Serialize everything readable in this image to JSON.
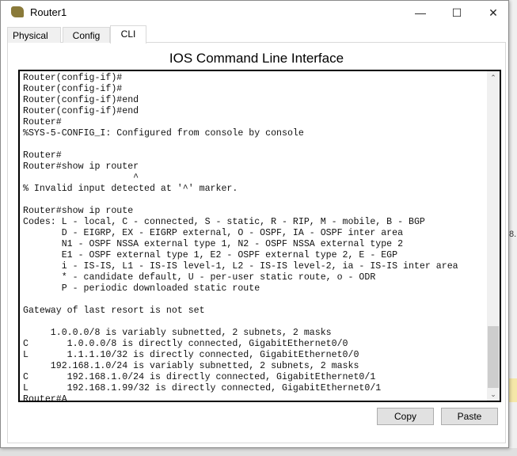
{
  "window": {
    "title": "Router1"
  },
  "tabs": [
    {
      "label": "Physical"
    },
    {
      "label": "Config"
    },
    {
      "label": "CLI",
      "active": true
    }
  ],
  "heading": "IOS Command Line Interface",
  "terminal": {
    "lines": [
      "Router(config-if)#",
      "Router(config-if)#",
      "Router(config-if)#",
      "Router(config-if)#end",
      "Router(config-if)#end",
      "Router#",
      "%SYS-5-CONFIG_I: Configured from console by console",
      "",
      "Router#",
      "Router#show ip router",
      "                    ^",
      "% Invalid input detected at '^' marker.",
      "",
      "Router#show ip route",
      "Codes: L - local, C - connected, S - static, R - RIP, M - mobile, B - BGP",
      "       D - EIGRP, EX - EIGRP external, O - OSPF, IA - OSPF inter area",
      "       N1 - OSPF NSSA external type 1, N2 - OSPF NSSA external type 2",
      "       E1 - OSPF external type 1, E2 - OSPF external type 2, E - EGP",
      "       i - IS-IS, L1 - IS-IS level-1, L2 - IS-IS level-2, ia - IS-IS inter area",
      "       * - candidate default, U - per-user static route, o - ODR",
      "       P - periodic downloaded static route",
      "",
      "Gateway of last resort is not set",
      "",
      "     1.0.0.0/8 is variably subnetted, 2 subnets, 2 masks",
      "C       1.0.0.0/8 is directly connected, GigabitEthernet0/0",
      "L       1.1.1.10/32 is directly connected, GigabitEthernet0/0",
      "     192.168.1.0/24 is variably subnetted, 2 subnets, 2 masks",
      "C       192.168.1.0/24 is directly connected, GigabitEthernet0/1",
      "L       192.168.1.99/32 is directly connected, GigabitEthernet0/1",
      "Router#A"
    ]
  },
  "buttons": {
    "copy": "Copy",
    "paste": "Paste"
  },
  "background": {
    "side_text": "8."
  }
}
